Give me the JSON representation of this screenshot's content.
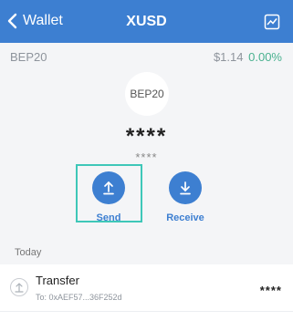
{
  "header": {
    "back_label": "Wallet",
    "title": "XUSD",
    "back_icon": "chevron-left-icon",
    "chart_icon": "chart-icon"
  },
  "token": {
    "network": "BEP20",
    "price": "$1.14",
    "change": "0.00%",
    "logo_text": "BEP20",
    "balance": "****",
    "fiat_balance": "****"
  },
  "actions": {
    "send_label": "Send",
    "receive_label": "Receive"
  },
  "transactions": {
    "section_title": "Today",
    "items": [
      {
        "title": "Transfer",
        "subtitle": "To: 0xAEF57...36F252d",
        "amount": "****"
      }
    ]
  },
  "colors": {
    "header": "#3d7fd1",
    "accent": "#3d7fd1",
    "positive": "#49b18f",
    "highlight": "#3ec7b8"
  }
}
